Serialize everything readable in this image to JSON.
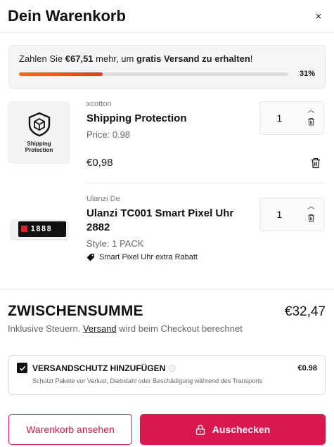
{
  "header": {
    "title": "Dein Warenkorb",
    "close_symbol": "×"
  },
  "shipping_bar": {
    "text_prefix": "Zahlen Sie ",
    "amount": "€67,51",
    "text_middle": " mehr, um ",
    "highlight": "gratis Versand zu erhalten",
    "text_suffix": "!",
    "percent_label": "31%",
    "progress": 0.31,
    "bar_color": "#e83a1f"
  },
  "items": [
    {
      "vendor": "xcotton",
      "name": "Shipping Protection",
      "meta": "Price: 0.98",
      "price": "€0,98",
      "quantity": "1",
      "thumb_text": "Shipping Protection",
      "thumb_icon": "shield-box-icon"
    },
    {
      "vendor": "Ulanzi De",
      "name": "Ulanzi TC001 Smart Pixel Uhr 2882",
      "meta": "Style: 1 PACK",
      "discount": "Smart Pixel Uhr extra Rabatt",
      "quantity": "1",
      "thumb_text": "1888",
      "thumb_icon": "pixel-clock-icon"
    }
  ],
  "footer": {
    "subtotal_label": "ZWISCHENSUMME",
    "subtotal_value": "€32,47",
    "tax_prefix": "Inklusive Steuern. ",
    "tax_link": "Versand",
    "tax_suffix": " wird beim Checkout berechnet",
    "protection": {
      "label": "VERSANDSCHUTZ HINZUFÜGEN",
      "price": "€0.98",
      "description": "Schützt Pakete vor Verlust, Diebstahl oder Beschädigung während des Transports",
      "checked": true
    },
    "view_cart_label": "Warenkorb ansehen",
    "checkout_label": "Auschecken"
  },
  "colors": {
    "brand": "#d9184f",
    "progress_start": "#ff6a1a",
    "progress_end": "#e83a1f"
  }
}
